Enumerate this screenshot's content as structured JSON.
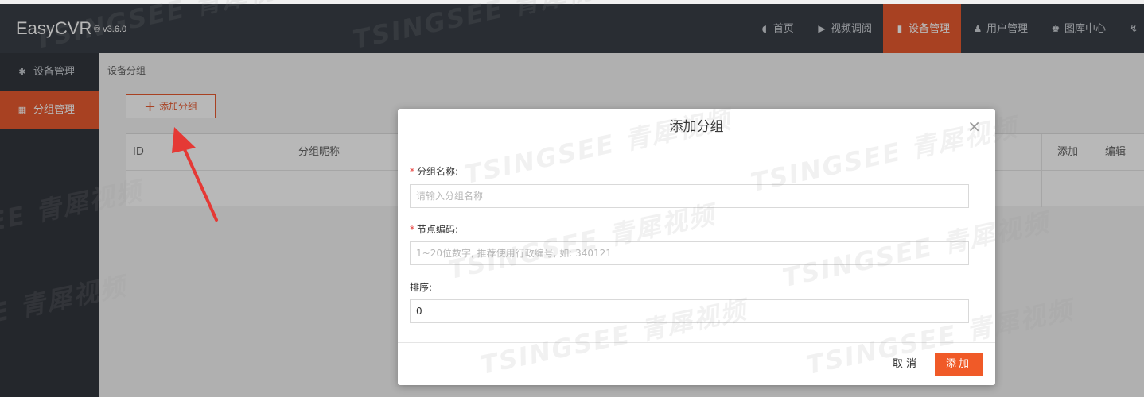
{
  "app": {
    "brand": "EasyCVR",
    "version": "® v3.6.0"
  },
  "nav": {
    "items": [
      {
        "icon": "dashboard-icon",
        "label": "首页"
      },
      {
        "icon": "play-icon",
        "label": "视频调阅"
      },
      {
        "icon": "device-icon",
        "label": "设备管理"
      },
      {
        "icon": "user-icon",
        "label": "用户管理"
      },
      {
        "icon": "library-icon",
        "label": "图库中心"
      },
      {
        "icon": "pulse-icon",
        "label": ""
      }
    ],
    "active_label": "设备管理"
  },
  "sidebar": {
    "items": [
      {
        "icon": "gear-icon",
        "label": "设备管理"
      },
      {
        "icon": "grid-icon",
        "label": "分组管理"
      }
    ]
  },
  "main": {
    "breadcrumb": "设备分组",
    "add_button_label": "添加分组",
    "table": {
      "headers": [
        "ID",
        "分组昵称",
        "添加",
        "编辑"
      ]
    }
  },
  "modal": {
    "title": "添加分组",
    "fields": [
      {
        "label": "分组名称:",
        "required": true,
        "placeholder": "请输入分组名称",
        "value": ""
      },
      {
        "label": "节点编码:",
        "required": true,
        "placeholder": "1~20位数字, 推荐使用行政编号, 如: 340121",
        "value": ""
      },
      {
        "label": "排序:",
        "required": false,
        "placeholder": "",
        "value": "0"
      }
    ],
    "cancel_label": "取 消",
    "submit_label": "添加"
  },
  "watermark": {
    "text": "TSINGSEE 青犀视频"
  },
  "colors": {
    "accent": "#e95b30",
    "topbar": "#3a3f47",
    "sidebar": "#33373e",
    "required": "#e53935"
  }
}
